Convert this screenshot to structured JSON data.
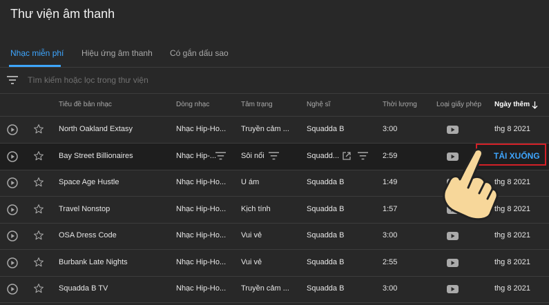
{
  "page": {
    "title": "Thư viện âm thanh"
  },
  "tabs": [
    "Nhạc miễn phí",
    "Hiệu ứng âm thanh",
    "Có gắn dấu sao"
  ],
  "search": {
    "placeholder": "Tìm kiếm hoặc lọc trong thư viện"
  },
  "columns": {
    "title": "Tiêu đề bản nhạc",
    "genre": "Dòng nhạc",
    "mood": "Tâm trạng",
    "artist": "Nghệ sĩ",
    "duration": "Thời lượng",
    "license": "Loại giấy phép",
    "added": "Ngày thêm"
  },
  "rows": [
    {
      "title": "North Oakland Extasy",
      "genre": "Nhạc Hip-Ho...",
      "mood": "Truyền cảm ...",
      "artist": "Squadda B",
      "duration": "3:00",
      "added": "thg 8 2021"
    },
    {
      "title": "Bay Street Billionaires",
      "genre": "Nhạc Hip-...",
      "mood": "Sôi nổi",
      "artist": "Squadd...",
      "duration": "2:59",
      "added": ""
    },
    {
      "title": "Space Age Hustle",
      "genre": "Nhạc Hip-Ho...",
      "mood": "U ám",
      "artist": "Squadda B",
      "duration": "1:49",
      "added": "thg 8 2021"
    },
    {
      "title": "Travel Nonstop",
      "genre": "Nhạc Hip-Ho...",
      "mood": "Kịch tính",
      "artist": "Squadda B",
      "duration": "1:57",
      "added": "thg 8 2021"
    },
    {
      "title": "OSA Dress Code",
      "genre": "Nhạc Hip-Ho...",
      "mood": "Vui vẻ",
      "artist": "Squadda B",
      "duration": "3:00",
      "added": "thg 8 2021"
    },
    {
      "title": "Burbank Late Nights",
      "genre": "Nhạc Hip-Ho...",
      "mood": "Vui vẻ",
      "artist": "Squadda B",
      "duration": "2:55",
      "added": "thg 8 2021"
    },
    {
      "title": "Squadda B TV",
      "genre": "Nhạc Hip-Ho...",
      "mood": "Truyền cảm ...",
      "artist": "Squadda B",
      "duration": "3:00",
      "added": "thg 8 2021"
    }
  ],
  "download_label": "TẢI XUỐNG",
  "colors": {
    "accent": "#3ea6ff",
    "highlight_box": "#d32027",
    "background": "#282828"
  },
  "icons": [
    "play-icon",
    "star-icon",
    "youtube-license-icon",
    "filter-icon",
    "sort-down-arrow-icon",
    "open-external-icon",
    "pointing-hand-icon"
  ]
}
